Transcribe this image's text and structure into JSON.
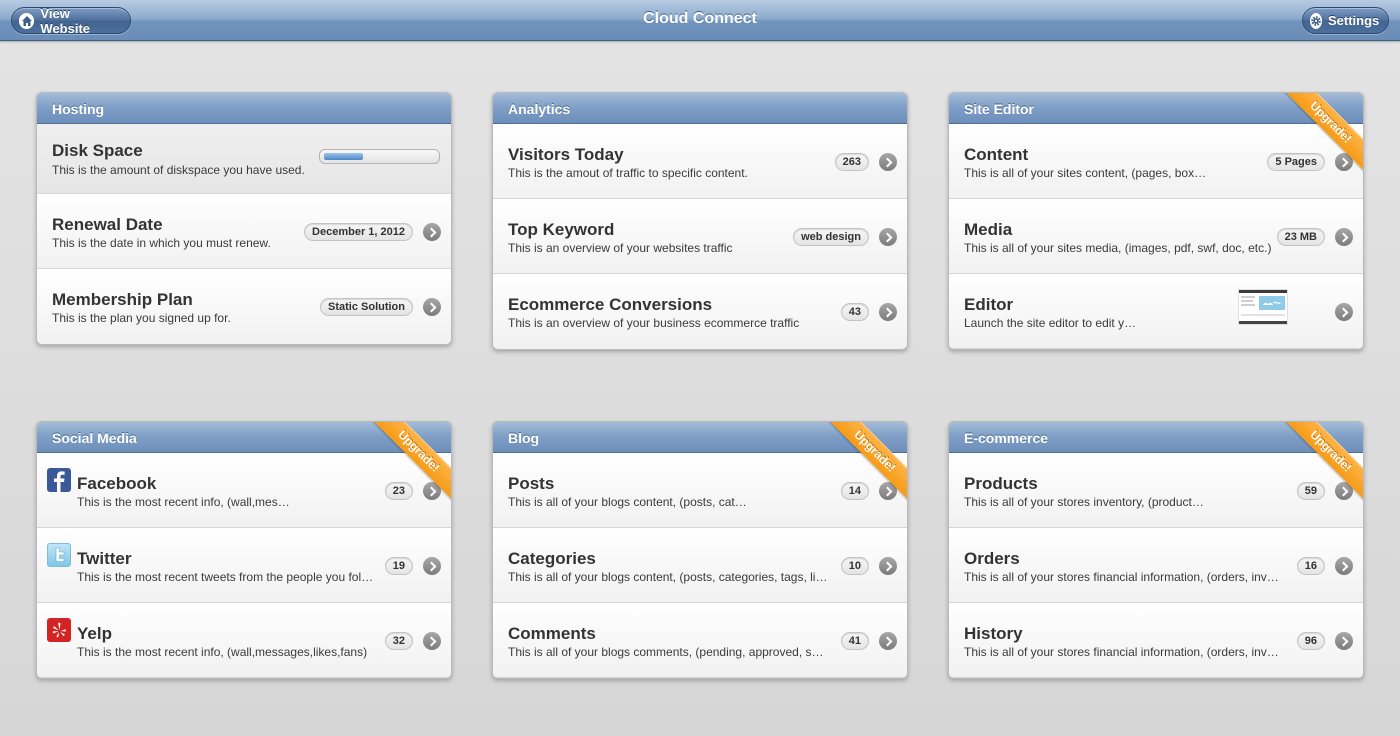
{
  "header": {
    "title": "Cloud Connect",
    "view_website_label": "View Website",
    "settings_label": "Settings"
  },
  "colors": {
    "accent": "#6d8fba",
    "ribbon": "#f59b16"
  },
  "hosting": {
    "title": "Hosting",
    "disk_space": {
      "title": "Disk Space",
      "subtitle": "This is the amount of diskspace you have used.",
      "usage_percent": 35
    },
    "renewal": {
      "title": "Renewal Date",
      "subtitle": "This is the date in which you must renew.",
      "badge": "December 1, 2012"
    },
    "plan": {
      "title": "Membership Plan",
      "subtitle": "This is the plan you signed up for.",
      "badge": "Static Solution"
    }
  },
  "analytics": {
    "title": "Analytics",
    "rows": [
      {
        "title": "Visitors Today",
        "subtitle": "This is the amout of traffic to specific content.",
        "badge": "263"
      },
      {
        "title": "Top Keyword",
        "subtitle": "This is an overview of your websites traffic",
        "badge": "web design"
      },
      {
        "title": "Ecommerce Conversions",
        "subtitle": "This is an overview of your business ecommerce traffic",
        "badge": "43"
      }
    ]
  },
  "site_editor": {
    "title": "Site Editor",
    "ribbon": "Upgrade!",
    "rows": [
      {
        "title": "Content",
        "subtitle": "This is all of your sites content, (pages, box…",
        "badge": "5 Pages"
      },
      {
        "title": "Media",
        "subtitle": "This is all of your sites media, (images, pdf, swf, doc, etc.)",
        "badge": "23 MB"
      },
      {
        "title": "Editor",
        "subtitle": "Launch the site editor to edit y…"
      }
    ]
  },
  "social_media": {
    "title": "Social Media",
    "ribbon": "Upgrade!",
    "rows": [
      {
        "title": "Facebook",
        "subtitle": "This is the most recent info, (wall,mes…",
        "badge": "23",
        "icon": "facebook-icon"
      },
      {
        "title": "Twitter",
        "subtitle": "This is the most recent tweets from the people you fol…",
        "badge": "19",
        "icon": "twitter-icon"
      },
      {
        "title": "Yelp",
        "subtitle": "This is the most recent info, (wall,messages,likes,fans)",
        "badge": "32",
        "icon": "yelp-icon"
      }
    ]
  },
  "blog": {
    "title": "Blog",
    "ribbon": "Upgrade!",
    "rows": [
      {
        "title": "Posts",
        "subtitle": "This is all of your blogs content, (posts, cat…",
        "badge": "14"
      },
      {
        "title": "Categories",
        "subtitle": "This is all of your blogs content, (posts, categories, tags, li…",
        "badge": "10"
      },
      {
        "title": "Comments",
        "subtitle": "This is all of your blogs comments, (pending, approved, s…",
        "badge": "41"
      }
    ]
  },
  "ecommerce": {
    "title": "E-commerce",
    "ribbon": "Upgrade!",
    "rows": [
      {
        "title": "Products",
        "subtitle": "This is all of your stores inventory, (product…",
        "badge": "59"
      },
      {
        "title": "Orders",
        "subtitle": "This is all of your stores financial information, (orders, inv…",
        "badge": "16"
      },
      {
        "title": "History",
        "subtitle": "This is all of your stores financial information, (orders, inv…",
        "badge": "96"
      }
    ]
  }
}
